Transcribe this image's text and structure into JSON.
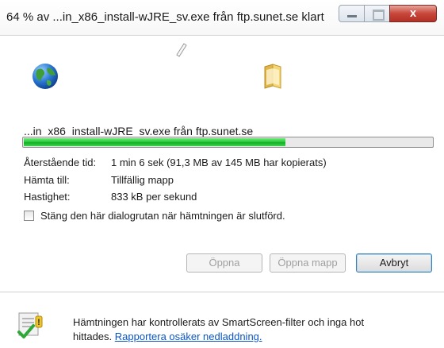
{
  "window": {
    "title": "64 % av ...in_x86_install-wJRE_sv.exe från ftp.sunet.se klart",
    "controls": {
      "minimize": "minimize",
      "maximize": "maximize",
      "close": "x"
    }
  },
  "icons": {
    "document": "document-icon",
    "globe": "globe-icon",
    "folder": "folder-icon",
    "shield": "smartscreen-shield-icon"
  },
  "download": {
    "source": "...in_x86_install-wJRE_sv.exe från ftp.sunet.se",
    "progress_fraction": 0.64,
    "rows": [
      {
        "label": "Återstående tid:",
        "value": "1 min 6 sek (91,3 MB av 145 MB har kopierats)"
      },
      {
        "label": "Hämta till:",
        "value": "Tillfällig mapp"
      },
      {
        "label": "Hastighet:",
        "value": "833 kB per sekund"
      }
    ]
  },
  "options": {
    "close_when_done_label": "Stäng den här dialogrutan när hämtningen är slutförd.",
    "close_when_done_checked": false
  },
  "buttons": {
    "open": "Öppna",
    "open_folder": "Öppna mapp",
    "cancel": "Avbryt"
  },
  "smartscreen": {
    "line1": "Hämtningen har kontrollerats av SmartScreen-filter och inga hot",
    "line2_prefix": "hittades.",
    "report_link": "Rapportera osäker nedladdning."
  },
  "colors": {
    "progress_green": "#2ccb3c",
    "link": "#0b55c4",
    "close_red": "#c8463a"
  }
}
